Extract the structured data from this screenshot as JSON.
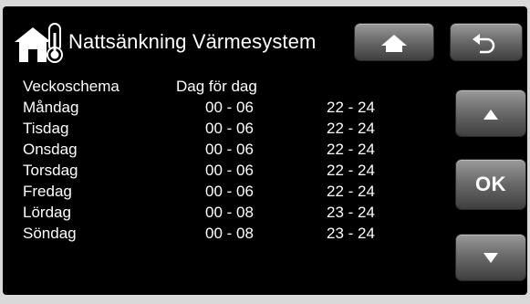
{
  "header": {
    "title": "Nattsänkning Värmesystem",
    "icon": "home-thermometer-icon"
  },
  "buttons": {
    "home": {
      "icon": "home-icon"
    },
    "back": {
      "icon": "back-arrow-icon"
    },
    "up": {
      "icon": "triangle-up-icon"
    },
    "ok": {
      "label": "OK"
    },
    "down": {
      "icon": "triangle-down-icon"
    }
  },
  "schedule": {
    "label": "Veckoschema",
    "mode": "Dag för dag",
    "days": [
      {
        "day": "Måndag",
        "period1": "00 - 06",
        "period2": "22 - 24"
      },
      {
        "day": "Tisdag",
        "period1": "00 - 06",
        "period2": "22 - 24"
      },
      {
        "day": "Onsdag",
        "period1": "00 - 06",
        "period2": "22 - 24"
      },
      {
        "day": "Torsdag",
        "period1": "00 - 06",
        "period2": "22 - 24"
      },
      {
        "day": "Fredag",
        "period1": "00 - 06",
        "period2": "22 - 24"
      },
      {
        "day": "Lördag",
        "period1": "00 - 08",
        "period2": "23 - 24"
      },
      {
        "day": "Söndag",
        "period1": "00 - 08",
        "period2": "23 - 24"
      }
    ]
  },
  "colors": {
    "background": "#000000",
    "text": "#ffffff",
    "button_top": "#9a9a9a",
    "button_bottom": "#3e3e3e",
    "icon_white": "#ffffff"
  }
}
